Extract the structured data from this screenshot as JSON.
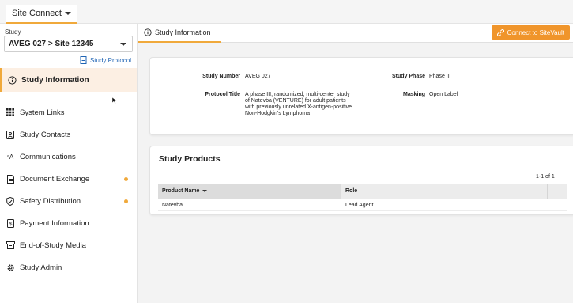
{
  "header": {
    "app_menu_label": "Site Connect"
  },
  "sidebar": {
    "study_label": "Study",
    "study_selected": "AVEG 027 > Site 12345",
    "study_protocol_link": "Study Protocol",
    "items": [
      {
        "label": "Study Information",
        "icon": "info-circle-icon",
        "active": true
      },
      {
        "label": "System Links",
        "icon": "grid-icon"
      },
      {
        "label": "Study Contacts",
        "icon": "contact-card-icon"
      },
      {
        "label": "Communications",
        "icon": "translate-icon"
      },
      {
        "label": "Document Exchange",
        "icon": "document-icon",
        "notification": true
      },
      {
        "label": "Safety Distribution",
        "icon": "shield-check-icon",
        "notification": true
      },
      {
        "label": "Payment Information",
        "icon": "receipt-icon"
      },
      {
        "label": "End-of-Study Media",
        "icon": "archive-box-icon"
      },
      {
        "label": "Study Admin",
        "icon": "gear-icon"
      }
    ]
  },
  "main": {
    "tab_label": "Study Information",
    "connect_button_label": "Connect to SiteVault",
    "info": {
      "study_number_label": "Study Number",
      "study_number_value": "AVEG 027",
      "protocol_title_label": "Protocol Title",
      "protocol_title_lines": [
        "A phase III, randomized, multi-center study",
        "of Natevba (VENTURE) for adult patients",
        "with previously unrelated X-antigen-positive",
        "Non-Hodgkin's Lymphoma"
      ],
      "study_phase_label": "Study Phase",
      "study_phase_value": "Phase III",
      "masking_label": "Masking",
      "masking_value": "Open Label"
    },
    "products": {
      "title": "Study Products",
      "count": "1-1 of 1",
      "columns": [
        "Product Name",
        "Role"
      ],
      "rows": [
        {
          "name": "Natevba",
          "role": "Lead Agent"
        }
      ]
    }
  },
  "colors": {
    "accent": "#f0a93b",
    "button": "#f0952b",
    "link": "#1f64b4",
    "active_bg": "#fcefe3"
  }
}
